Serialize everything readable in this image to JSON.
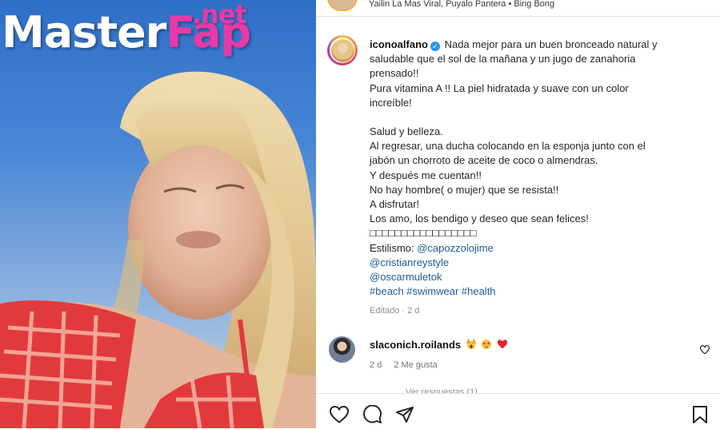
{
  "watermark": {
    "master": "Master",
    "fap": "Fap",
    "net": ".net"
  },
  "music": {
    "text": "Yailin La Mas Viral, Puyalo Pantera • Bing Bong"
  },
  "post": {
    "username": "iconoalfano",
    "verified_icon": "verified-badge-icon",
    "caption_first": "Nada mejor para un buen bronceado natural y",
    "caption_lines": [
      "saludable que el sol de la mañana y un jugo de zanahoria",
      "prensado!!",
      "Pura vitamina A !! La piel hidratada y suave con un color",
      "increíble!"
    ],
    "caption_lines_2": [
      "Salud y belleza.",
      "Al regresar, una ducha colocando en la esponja junto con el",
      "jabón un chorroto de aceite de coco o almendras.",
      "Y después me cuentan!!",
      "No hay hombre( o mujer) que se resista!!",
      "A disfrutar!",
      "Los amo, los bendigo y deseo que sean felices!",
      "□□□□□□□□□□□□□□□□□"
    ],
    "stylist_label": "Estilismo: ",
    "mentions": [
      "@capozzolojime",
      "@cristianreystyle",
      "@oscarmuletok"
    ],
    "hashtags": "#beach #swimwear #health",
    "edited": "Editado · 2 d"
  },
  "comment": {
    "username": "slaconich.roilands",
    "emojis": [
      "hands-raised-emoji",
      "star-struck-emoji",
      "red-heart-emoji"
    ],
    "age": "2 d",
    "likes": "2 Me gusta"
  },
  "replies_text": "Ver respuestas (1)",
  "actions": {
    "icons": [
      "heart-icon",
      "comment-icon",
      "share-icon",
      "bookmark-icon"
    ]
  },
  "colors": {
    "link": "#1d5a9b",
    "verified": "#2a95f6",
    "watermark_accent": "#e83aa6"
  }
}
